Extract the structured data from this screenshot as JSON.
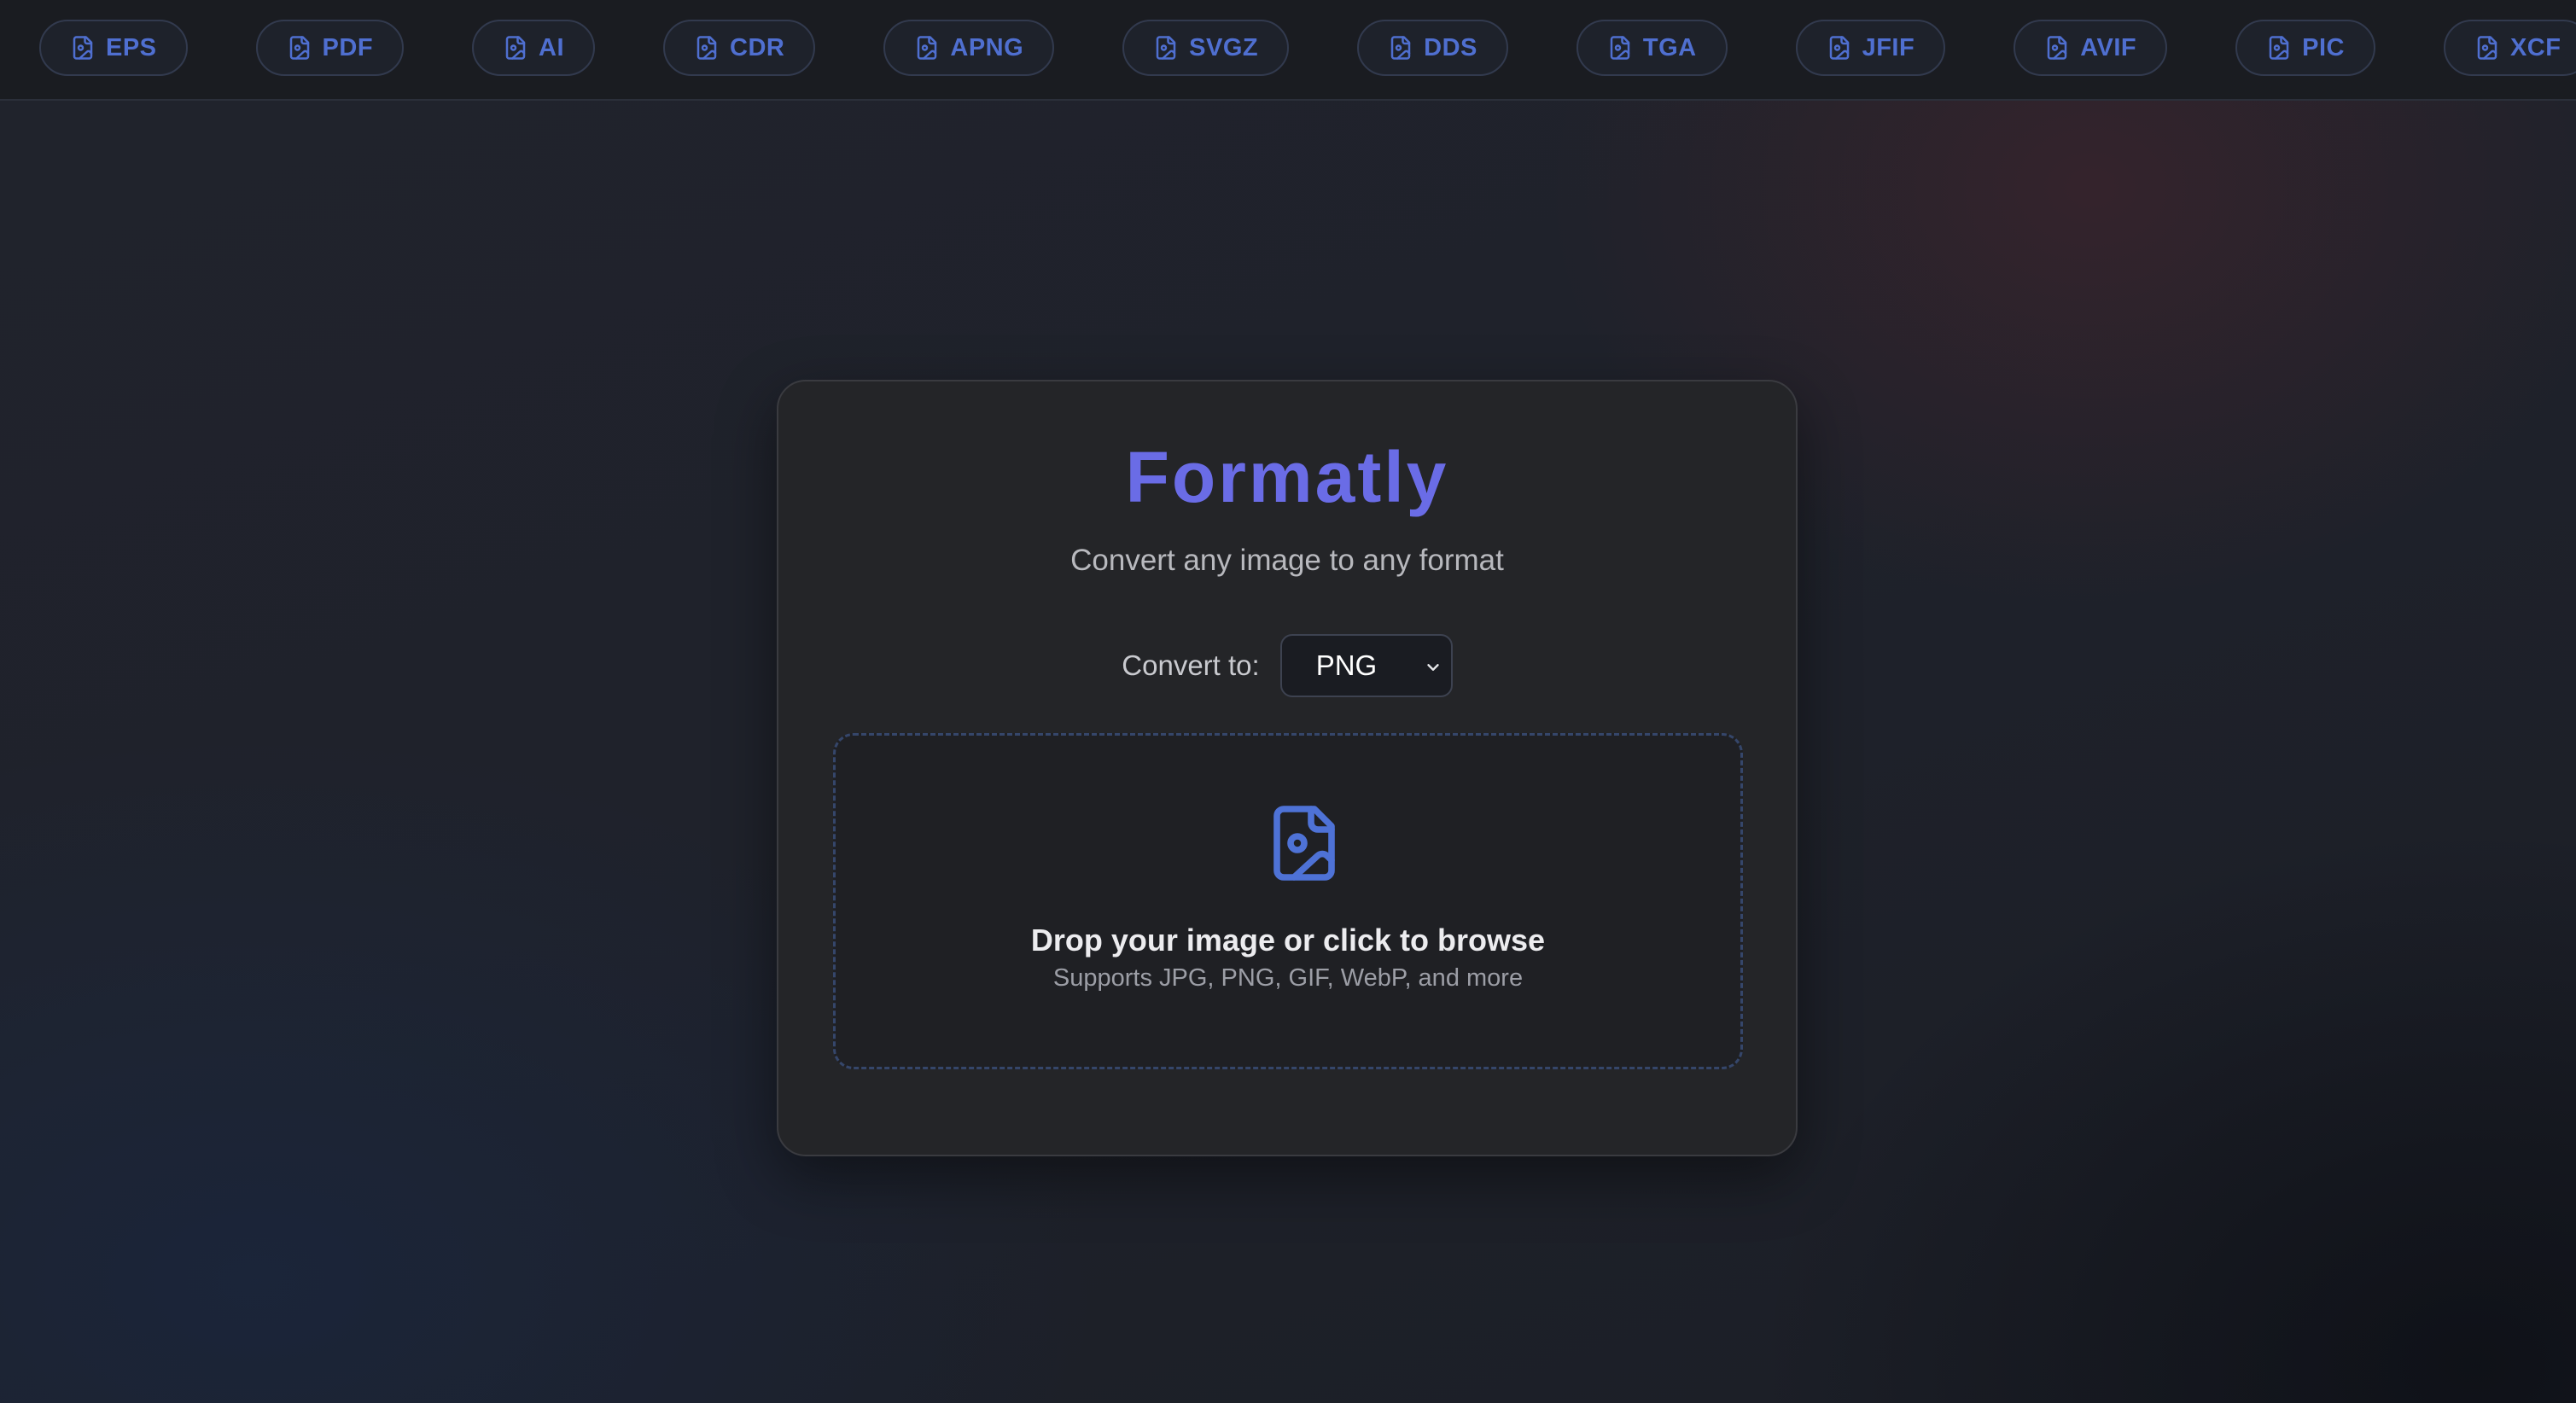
{
  "format_bar": {
    "formats": [
      "EPS",
      "PDF",
      "AI",
      "CDR",
      "APNG",
      "SVGZ",
      "DDS",
      "TGA",
      "JFIF",
      "AVIF",
      "PIC",
      "XCF"
    ],
    "chip_icon": "file-image-icon",
    "chip_color": "#4f6fd0"
  },
  "card": {
    "title": "Formatly",
    "subtitle": "Convert any image to any format",
    "convert_label": "Convert to:",
    "selected_format": "PNG",
    "dropdown_icon": "chevron-down-icon",
    "accent_color": "#6a6ce6"
  },
  "dropzone": {
    "icon": "file-image-icon",
    "title": "Drop your image or click to browse",
    "subtitle": "Supports JPG, PNG, GIF, WebP, and more"
  }
}
